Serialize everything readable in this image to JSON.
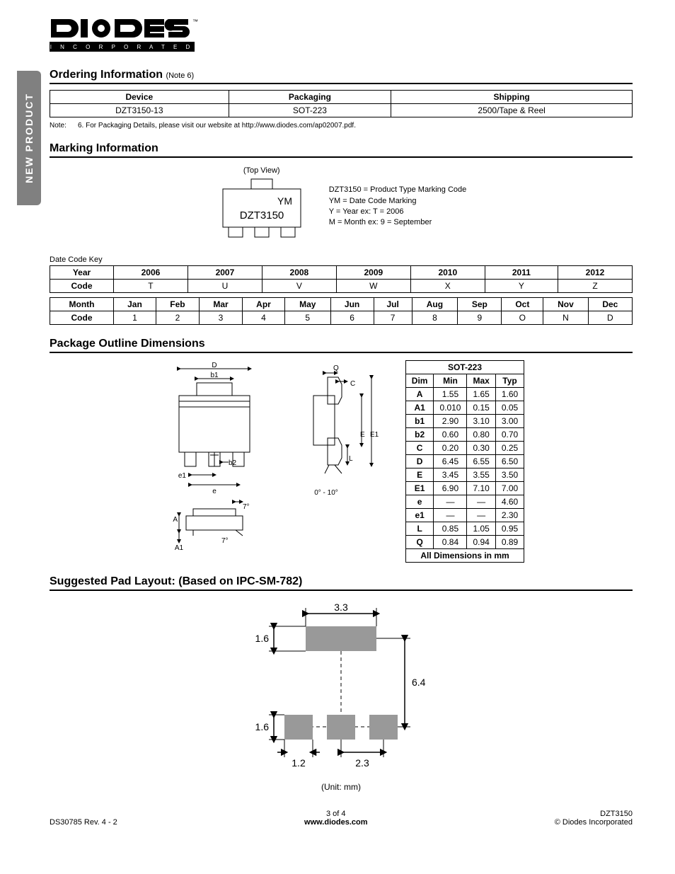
{
  "sidebar_text": "NEW PRODUCT",
  "logo": {
    "brand": "DIODES",
    "tag": "I N C O R P O R A T E D"
  },
  "ordering": {
    "heading": "Ordering Information",
    "heading_note": "(Note 6)",
    "headers": [
      "Device",
      "Packaging",
      "Shipping"
    ],
    "row": [
      "DZT3150-13",
      "SOT-223",
      "2500/Tape & Reel"
    ],
    "note_label": "Note:",
    "note_text": "6. For Packaging Details, please visit our website at http://www.diodes.com/ap02007.pdf."
  },
  "marking": {
    "heading": "Marking Information",
    "top_view": "(Top View)",
    "chip_ym": "YM",
    "chip_code": "DZT3150",
    "legend": {
      "l1": "DZT3150 = Product Type Marking Code",
      "l2": "YM = Date Code Marking",
      "l3": "Y = Year ex: T = 2006",
      "l4": "M = Month ex: 9 = September"
    },
    "date_key_label": "Date Code Key",
    "year_table": {
      "row_labels": [
        "Year",
        "Code"
      ],
      "years": [
        "2006",
        "2007",
        "2008",
        "2009",
        "2010",
        "2011",
        "2012"
      ],
      "codes": [
        "T",
        "U",
        "V",
        "W",
        "X",
        "Y",
        "Z"
      ]
    },
    "month_table": {
      "row_labels": [
        "Month",
        "Code"
      ],
      "months": [
        "Jan",
        "Feb",
        "Mar",
        "Apr",
        "May",
        "Jun",
        "Jul",
        "Aug",
        "Sep",
        "Oct",
        "Nov",
        "Dec"
      ],
      "codes": [
        "1",
        "2",
        "3",
        "4",
        "5",
        "6",
        "7",
        "8",
        "9",
        "O",
        "N",
        "D"
      ]
    }
  },
  "package": {
    "heading": "Package Outline Dimensions",
    "diagram_labels": {
      "D": "D",
      "b1": "b1",
      "b2": "b2",
      "e1": "e1",
      "e": "e",
      "a": "A",
      "a1": "A1",
      "seven": "7°",
      "seven2": "7°",
      "Q": "Q",
      "C": "C",
      "E": "E",
      "E1": "E1",
      "L": "L",
      "angle": "0° - 10°"
    },
    "table": {
      "title": "SOT-223",
      "headers": [
        "Dim",
        "Min",
        "Max",
        "Typ"
      ],
      "rows": [
        [
          "A",
          "1.55",
          "1.65",
          "1.60"
        ],
        [
          "A1",
          "0.010",
          "0.15",
          "0.05"
        ],
        [
          "b1",
          "2.90",
          "3.10",
          "3.00"
        ],
        [
          "b2",
          "0.60",
          "0.80",
          "0.70"
        ],
        [
          "C",
          "0.20",
          "0.30",
          "0.25"
        ],
        [
          "D",
          "6.45",
          "6.55",
          "6.50"
        ],
        [
          "E",
          "3.45",
          "3.55",
          "3.50"
        ],
        [
          "E1",
          "6.90",
          "7.10",
          "7.00"
        ],
        [
          "e",
          "—",
          "—",
          "4.60"
        ],
        [
          "e1",
          "—",
          "—",
          "2.30"
        ],
        [
          "L",
          "0.85",
          "1.05",
          "0.95"
        ],
        [
          "Q",
          "0.84",
          "0.94",
          "0.89"
        ]
      ],
      "footer": "All Dimensions in mm"
    }
  },
  "pad": {
    "heading": "Suggested Pad Layout: (Based on IPC-SM-782)",
    "dims": {
      "top_w": "3.3",
      "h1": "1.6",
      "gap": "6.4",
      "h2": "1.6",
      "bot_w": "1.2",
      "pitch": "2.3"
    },
    "unit": "(Unit: mm)"
  },
  "footer": {
    "left": "DS30785 Rev. 4 - 2",
    "center_page": "3 of 4",
    "center_url": "www.diodes.com",
    "right_part": "DZT3150",
    "right_copy": "© Diodes Incorporated"
  }
}
